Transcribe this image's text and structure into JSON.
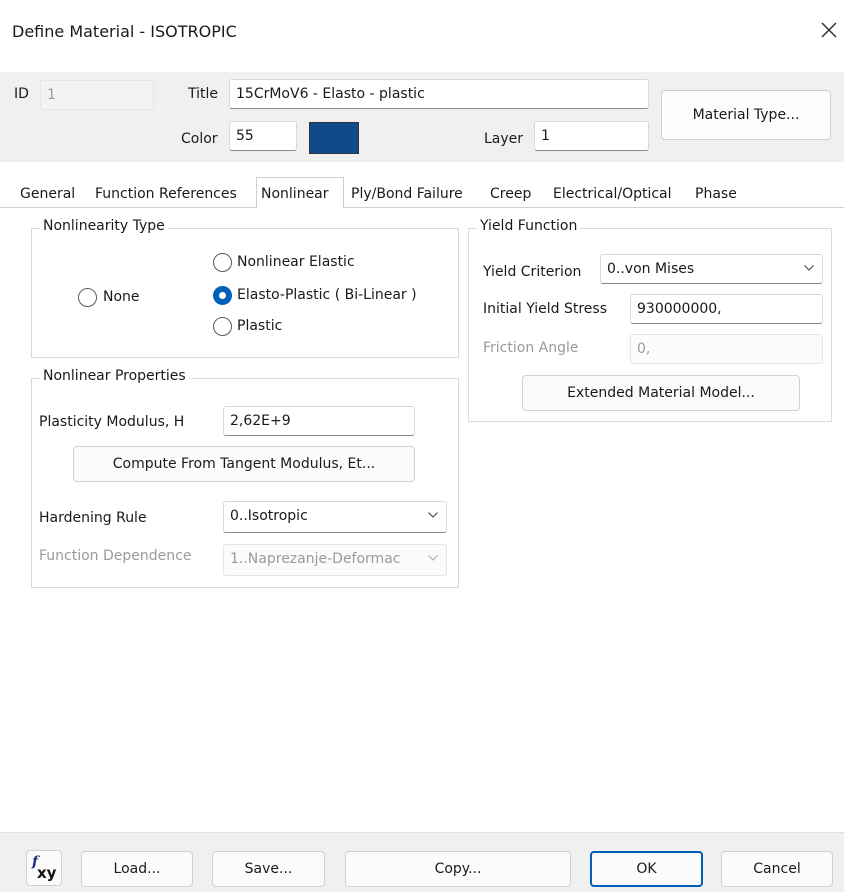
{
  "window": {
    "title": "Define Material - ISOTROPIC"
  },
  "header": {
    "id_label": "ID",
    "id_value": "1",
    "title_label": "Title",
    "title_value": "15CrMoV6 - Elasto - plastic",
    "color_label": "Color",
    "color_value": "55",
    "color_swatch": "#0e4a8c",
    "layer_label": "Layer",
    "layer_value": "1",
    "material_type_button": "Material Type..."
  },
  "tabs": [
    {
      "label": "General"
    },
    {
      "label": "Function References"
    },
    {
      "label": "Nonlinear"
    },
    {
      "label": "Ply/Bond Failure"
    },
    {
      "label": "Creep"
    },
    {
      "label": "Electrical/Optical"
    },
    {
      "label": "Phase"
    }
  ],
  "nonlinearity_type": {
    "title": "Nonlinearity Type",
    "options": [
      {
        "label": "None",
        "checked": false
      },
      {
        "label": "Nonlinear Elastic",
        "checked": false
      },
      {
        "label": "Elasto-Plastic ( Bi-Linear )",
        "checked": true
      },
      {
        "label": "Plastic",
        "checked": false
      }
    ]
  },
  "nonlinear_properties": {
    "title": "Nonlinear Properties",
    "plasticity_label": "Plasticity Modulus, H",
    "plasticity_value": "2,62E+9",
    "compute_button": "Compute From Tangent Modulus, Et...",
    "hardening_label": "Hardening Rule",
    "hardening_value": "0..Isotropic",
    "function_dependence_label": "Function Dependence",
    "function_dependence_value": "1..Naprezanje-Deformac"
  },
  "yield_function": {
    "title": "Yield Function",
    "criterion_label": "Yield Criterion",
    "criterion_value": "0..von Mises",
    "initial_stress_label": "Initial Yield Stress",
    "initial_stress_value": "930000000,",
    "friction_label": "Friction Angle",
    "friction_value": "0,",
    "extended_button": "Extended Material Model..."
  },
  "footer": {
    "fxy_icon": "fxy-icon",
    "load": "Load...",
    "save": "Save...",
    "copy": "Copy...",
    "ok": "OK",
    "cancel": "Cancel",
    "accent": "#005fb8"
  }
}
